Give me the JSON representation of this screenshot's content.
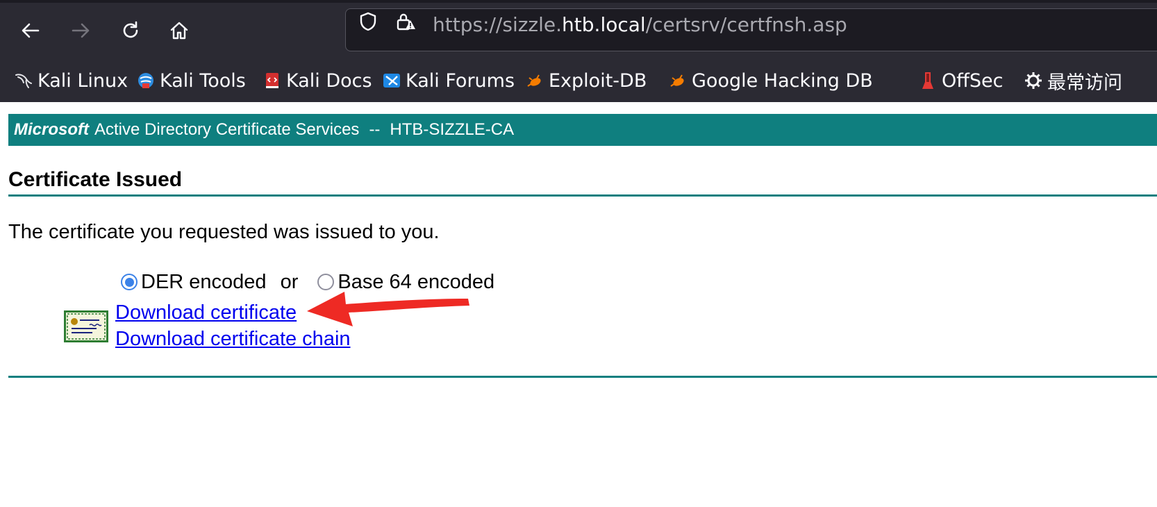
{
  "browser": {
    "url": {
      "prefix": "https://sizzle.",
      "host": "htb.local",
      "path": "/certsrv/certfnsh.asp"
    },
    "bookmarks": [
      {
        "label": "Kali Linux",
        "icon": "kali-dragon-icon"
      },
      {
        "label": "Kali Tools",
        "icon": "kali-tools-icon"
      },
      {
        "label": "Kali Docs",
        "icon": "kali-docs-icon"
      },
      {
        "label": "Kali Forums",
        "icon": "kali-forums-icon"
      },
      {
        "label": "Exploit-DB",
        "icon": "exploit-db-icon"
      },
      {
        "label": "Google Hacking DB",
        "icon": "ghdb-icon"
      },
      {
        "label": "OffSec",
        "icon": "offsec-icon"
      },
      {
        "label": "最常访问",
        "icon": "gear-icon"
      }
    ]
  },
  "page": {
    "ca_header": {
      "brand": "Microsoft",
      "service": "Active Directory Certificate Services",
      "separator": "--",
      "ca_name": "HTB-SIZZLE-CA"
    },
    "title": "Certificate Issued",
    "message": "The certificate you requested was issued to you.",
    "encoding": {
      "der_label": "DER encoded",
      "or_label": "or",
      "base64_label": "Base 64 encoded",
      "selected": "DER encoded"
    },
    "links": {
      "download_certificate": "Download certificate",
      "download_chain": "Download certificate chain"
    }
  },
  "colors": {
    "chrome_bg": "#2b2a33",
    "ca_bar": "#0f7f7f",
    "link": "#0000ee",
    "annotation_arrow": "#ee2a24",
    "radio_accent": "#3b82e8"
  }
}
